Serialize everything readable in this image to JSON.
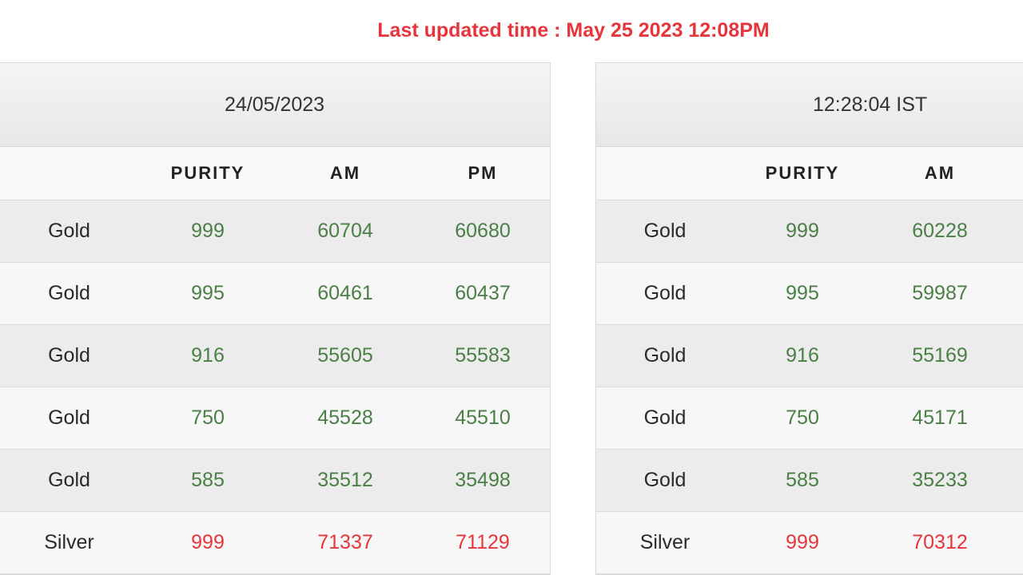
{
  "header": {
    "last_updated": "Last updated time : May 25 2023 12:08PM"
  },
  "left_panel": {
    "title": "24/05/2023",
    "columns": [
      "",
      "PURITY",
      "AM",
      "PM"
    ],
    "rows": [
      {
        "metal": "Gold",
        "purity": "999",
        "am": "60704",
        "pm": "60680"
      },
      {
        "metal": "Gold",
        "purity": "995",
        "am": "60461",
        "pm": "60437"
      },
      {
        "metal": "Gold",
        "purity": "916",
        "am": "55605",
        "pm": "55583"
      },
      {
        "metal": "Gold",
        "purity": "750",
        "am": "45528",
        "pm": "45510"
      },
      {
        "metal": "Gold",
        "purity": "585",
        "am": "35512",
        "pm": "35498"
      },
      {
        "metal": "Silver",
        "purity": "999",
        "am": "71337",
        "pm": "71129"
      }
    ]
  },
  "right_panel": {
    "title": "12:28:04 IST",
    "columns": [
      "",
      "PURITY",
      "AM"
    ],
    "rows": [
      {
        "metal": "Gold",
        "purity": "999",
        "am": "60228"
      },
      {
        "metal": "Gold",
        "purity": "995",
        "am": "59987"
      },
      {
        "metal": "Gold",
        "purity": "916",
        "am": "55169"
      },
      {
        "metal": "Gold",
        "purity": "750",
        "am": "45171"
      },
      {
        "metal": "Gold",
        "purity": "585",
        "am": "35233"
      },
      {
        "metal": "Silver",
        "purity": "999",
        "am": "70312"
      }
    ]
  },
  "colors": {
    "updated_text": "#e8353b",
    "gold_value": "#4a7f45",
    "silver_value": "#e8353b"
  }
}
